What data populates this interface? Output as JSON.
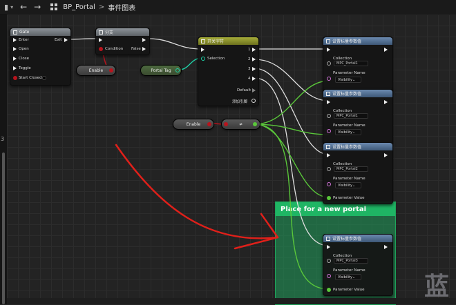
{
  "topbar": {
    "menu_icon": "graph-icon",
    "caret": "▾",
    "back": "←",
    "forward": "→",
    "blueprint": "BP_Portal",
    "separator": ">",
    "graph": "事件图表"
  },
  "gate": {
    "title": "Gate",
    "enter": "Enter",
    "exit": "Exit",
    "open": "Open",
    "close": "Close",
    "toggle": "Toggle",
    "start_closed": "Start Closed"
  },
  "branch": {
    "title": "分支",
    "condition": "Condition",
    "false": "False"
  },
  "enable_a": "Enable",
  "portal_tag": "Portal Tag",
  "switch_node": {
    "title": "开关字符",
    "selection": "Selection",
    "outputs": [
      "1",
      "2",
      "3",
      "4"
    ],
    "default": "Default",
    "add_pin": "添加引脚"
  },
  "enable_b": "Enable",
  "not_op": "≠",
  "set_param_nodes": [
    {
      "title": "设置标量参数值",
      "collection_label": "Collection",
      "collection_value": "MPC_Portal1",
      "param_label": "Parameter Name",
      "param_value": "Visibility"
    },
    {
      "title": "设置标量参数值",
      "collection_label": "Collection",
      "collection_value": "MPC_Portal1",
      "param_label": "Parameter Name",
      "param_value": "Visibility"
    },
    {
      "title": "设置标量参数值",
      "collection_label": "Collection",
      "collection_value": "MPC_Portal2",
      "param_label": "Parameter Name",
      "param_value": "Visibility",
      "value_label": "Parameter Value"
    },
    {
      "title": "设置标量参数值",
      "collection_label": "Collection",
      "collection_value": "MPC_Portal3",
      "param_label": "Parameter Name",
      "param_value": "Visibility",
      "value_label": "Parameter Value"
    }
  ],
  "comment": "Place for a new portal",
  "watermark": "蓝",
  "leftbar_number": "3",
  "colors": {
    "comment": "#1fb564",
    "exec_wire": "#dddddd",
    "bool_pin": "#b8141d",
    "name_pin": "#1fd2a8",
    "float_pin": "#5ac73a",
    "annotation": "#e0201a"
  }
}
